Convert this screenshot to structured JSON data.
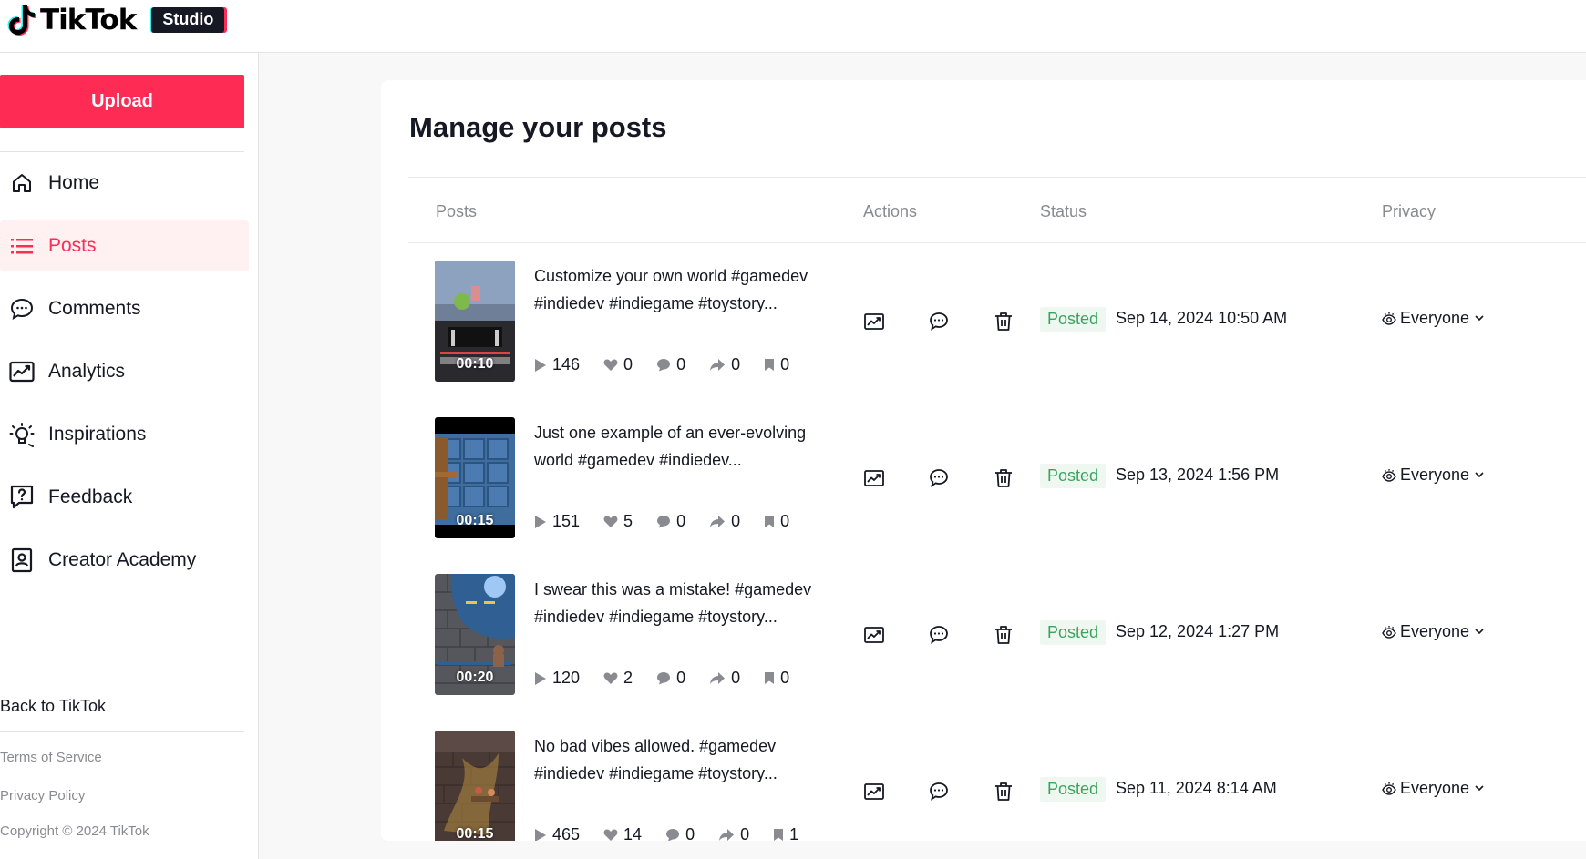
{
  "app": {
    "brand": "TikTok",
    "badge": "Studio"
  },
  "sidebar": {
    "upload_label": "Upload",
    "items": [
      {
        "label": "Home",
        "icon": "home-icon"
      },
      {
        "label": "Posts",
        "icon": "list-icon",
        "active": true
      },
      {
        "label": "Comments",
        "icon": "comment-icon"
      },
      {
        "label": "Analytics",
        "icon": "analytics-icon"
      },
      {
        "label": "Inspirations",
        "icon": "lightbulb-icon"
      },
      {
        "label": "Feedback",
        "icon": "feedback-icon"
      },
      {
        "label": "Creator Academy",
        "icon": "academy-icon"
      }
    ],
    "back_label": "Back to TikTok",
    "terms": "Terms of Service",
    "privacy_policy": "Privacy Policy",
    "copyright": "Copyright © 2024 TikTok"
  },
  "main": {
    "title": "Manage your posts",
    "columns": [
      "Posts",
      "Actions",
      "Status",
      "Privacy"
    ],
    "posts": [
      {
        "duration": "00:10",
        "caption_line1": "Customize your own world #gamedev",
        "caption_line2": "#indiedev #indiegame #toystory...",
        "views": "146",
        "likes": "0",
        "comments": "0",
        "shares": "0",
        "saves": "0",
        "status": "Posted",
        "date": "Sep 14, 2024 10:50 AM",
        "privacy": "Everyone"
      },
      {
        "duration": "00:15",
        "caption_line1": "Just one example of an ever-evolving",
        "caption_line2": "world #gamedev #indiedev...",
        "views": "151",
        "likes": "5",
        "comments": "0",
        "shares": "0",
        "saves": "0",
        "status": "Posted",
        "date": "Sep 13, 2024 1:56 PM",
        "privacy": "Everyone"
      },
      {
        "duration": "00:20",
        "caption_line1": "I swear this was a mistake! #gamedev",
        "caption_line2": "#indiedev #indiegame #toystory...",
        "views": "120",
        "likes": "2",
        "comments": "0",
        "shares": "0",
        "saves": "0",
        "status": "Posted",
        "date": "Sep 12, 2024 1:27 PM",
        "privacy": "Everyone"
      },
      {
        "duration": "00:15",
        "caption_line1": "No bad vibes allowed. #gamedev",
        "caption_line2": "#indiedev #indiegame #toystory...",
        "views": "465",
        "likes": "14",
        "comments": "0",
        "shares": "0",
        "saves": "1",
        "status": "Posted",
        "date": "Sep 11, 2024 8:14 AM",
        "privacy": "Everyone"
      }
    ]
  },
  "colors": {
    "accent": "#fe2c55",
    "status_green": "#3aa45f",
    "muted_text": "#8a8b91"
  }
}
